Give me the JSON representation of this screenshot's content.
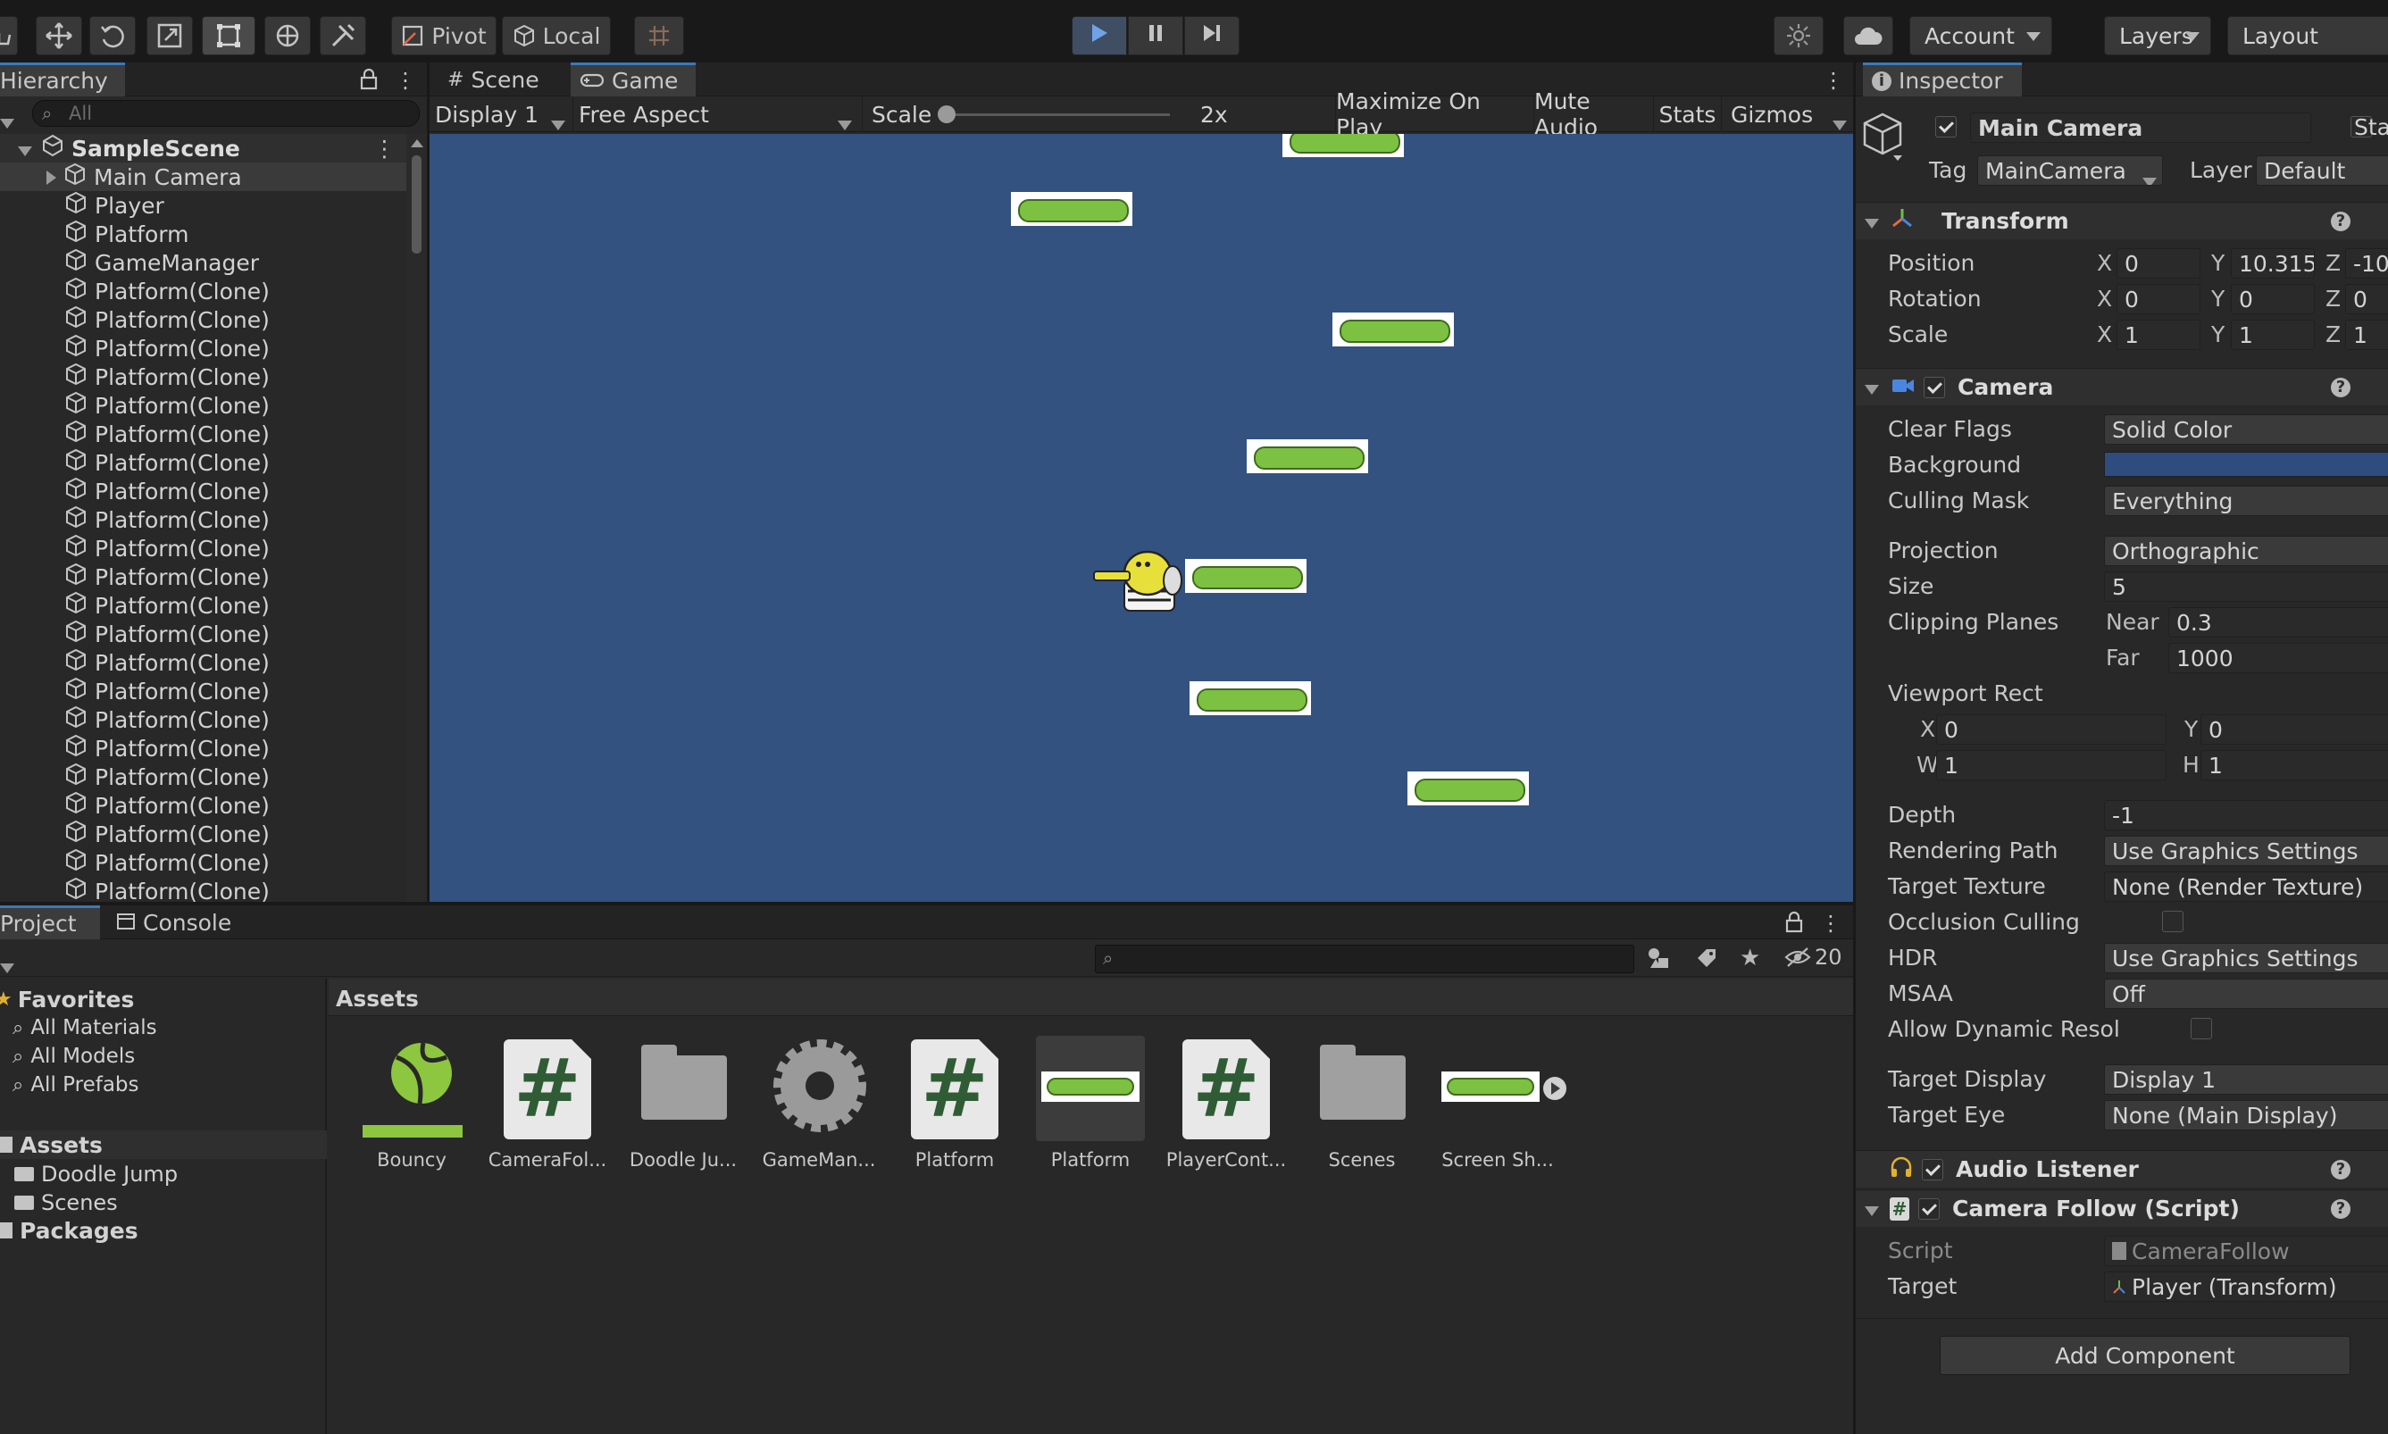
{
  "toolbar": {
    "pivot_label": "Pivot",
    "local_label": "Local",
    "account_label": "Account",
    "layers_label": "Layers",
    "layout_label": "Layout"
  },
  "hierarchy": {
    "tab_label": "Hierarchy",
    "search_placeholder": "All",
    "scene_name": "SampleScene",
    "items": [
      {
        "label": "Main Camera"
      },
      {
        "label": "Player"
      },
      {
        "label": "Platform"
      },
      {
        "label": "GameManager"
      },
      {
        "label": "Platform(Clone)"
      },
      {
        "label": "Platform(Clone)"
      },
      {
        "label": "Platform(Clone)"
      },
      {
        "label": "Platform(Clone)"
      },
      {
        "label": "Platform(Clone)"
      },
      {
        "label": "Platform(Clone)"
      },
      {
        "label": "Platform(Clone)"
      },
      {
        "label": "Platform(Clone)"
      },
      {
        "label": "Platform(Clone)"
      },
      {
        "label": "Platform(Clone)"
      },
      {
        "label": "Platform(Clone)"
      },
      {
        "label": "Platform(Clone)"
      },
      {
        "label": "Platform(Clone)"
      },
      {
        "label": "Platform(Clone)"
      },
      {
        "label": "Platform(Clone)"
      },
      {
        "label": "Platform(Clone)"
      },
      {
        "label": "Platform(Clone)"
      },
      {
        "label": "Platform(Clone)"
      },
      {
        "label": "Platform(Clone)"
      },
      {
        "label": "Platform(Clone)"
      },
      {
        "label": "Platform(Clone)"
      },
      {
        "label": "Platform(Clone)"
      }
    ]
  },
  "view": {
    "scene_tab": "Scene",
    "game_tab": "Game",
    "display": "Display 1",
    "aspect": "Free Aspect",
    "scale_label": "Scale",
    "scale_value": "2x",
    "maximize": "Maximize On Play",
    "mute": "Mute Audio",
    "stats": "Stats",
    "gizmos": "Gizmos",
    "background_color": "#34527f"
  },
  "inspector": {
    "tab_label": "Inspector",
    "object_name": "Main Camera",
    "static_label": "Stat",
    "tag_label": "Tag",
    "tag_value": "MainCamera",
    "layer_label": "Layer",
    "layer_value": "Default",
    "transform": {
      "title": "Transform",
      "position_label": "Position",
      "rotation_label": "Rotation",
      "scale_label": "Scale",
      "position": {
        "x": "0",
        "y": "10.315",
        "z": "-10"
      },
      "rotation": {
        "x": "0",
        "y": "0",
        "z": "0"
      },
      "scale": {
        "x": "1",
        "y": "1",
        "z": "1"
      }
    },
    "camera": {
      "title": "Camera",
      "clear_flags_label": "Clear Flags",
      "clear_flags": "Solid Color",
      "background_label": "Background",
      "background_color": "#2e4c7e",
      "culling_mask_label": "Culling Mask",
      "culling_mask": "Everything",
      "projection_label": "Projection",
      "projection": "Orthographic",
      "size_label": "Size",
      "size": "5",
      "clipping_label": "Clipping Planes",
      "near_label": "Near",
      "near": "0.3",
      "far_label": "Far",
      "far": "1000",
      "viewport_label": "Viewport Rect",
      "vx": "0",
      "vy": "0",
      "vw": "1",
      "vh": "1",
      "depth_label": "Depth",
      "depth": "-1",
      "rendering_path_label": "Rendering Path",
      "rendering_path": "Use Graphics Settings",
      "target_texture_label": "Target Texture",
      "target_texture": "None (Render Texture)",
      "occlusion_label": "Occlusion Culling",
      "hdr_label": "HDR",
      "hdr": "Use Graphics Settings",
      "msaa_label": "MSAA",
      "msaa": "Off",
      "dynamic_res_label": "Allow Dynamic Resol",
      "target_display_label": "Target Display",
      "target_display": "Display 1",
      "target_eye_label": "Target Eye",
      "target_eye": "None (Main Display)"
    },
    "audio_listener": "Audio Listener",
    "camera_follow": {
      "title": "Camera Follow (Script)",
      "script_label": "Script",
      "script_value": "CameraFollow",
      "target_label": "Target",
      "target_value": "Player (Transform)"
    },
    "add_component": "Add Component"
  },
  "project": {
    "project_tab": "Project",
    "console_tab": "Console",
    "hidden_count": "20",
    "favorites": "Favorites",
    "fav_items": [
      "All Materials",
      "All Models",
      "All Prefabs"
    ],
    "assets_label": "Assets",
    "asset_folders": [
      "Doodle Jump",
      "Scenes"
    ],
    "packages_label": "Packages",
    "breadcrumb": "Assets",
    "assets": [
      {
        "label": "Bouncy",
        "kind": "physics-material"
      },
      {
        "label": "CameraFol...",
        "kind": "script"
      },
      {
        "label": "Doodle Ju...",
        "kind": "folder"
      },
      {
        "label": "GameMan...",
        "kind": "gear"
      },
      {
        "label": "Platform",
        "kind": "script"
      },
      {
        "label": "Platform",
        "kind": "prefab"
      },
      {
        "label": "PlayerCont...",
        "kind": "script"
      },
      {
        "label": "Scenes",
        "kind": "folder"
      },
      {
        "label": "Screen Sh...",
        "kind": "sprite"
      }
    ]
  }
}
